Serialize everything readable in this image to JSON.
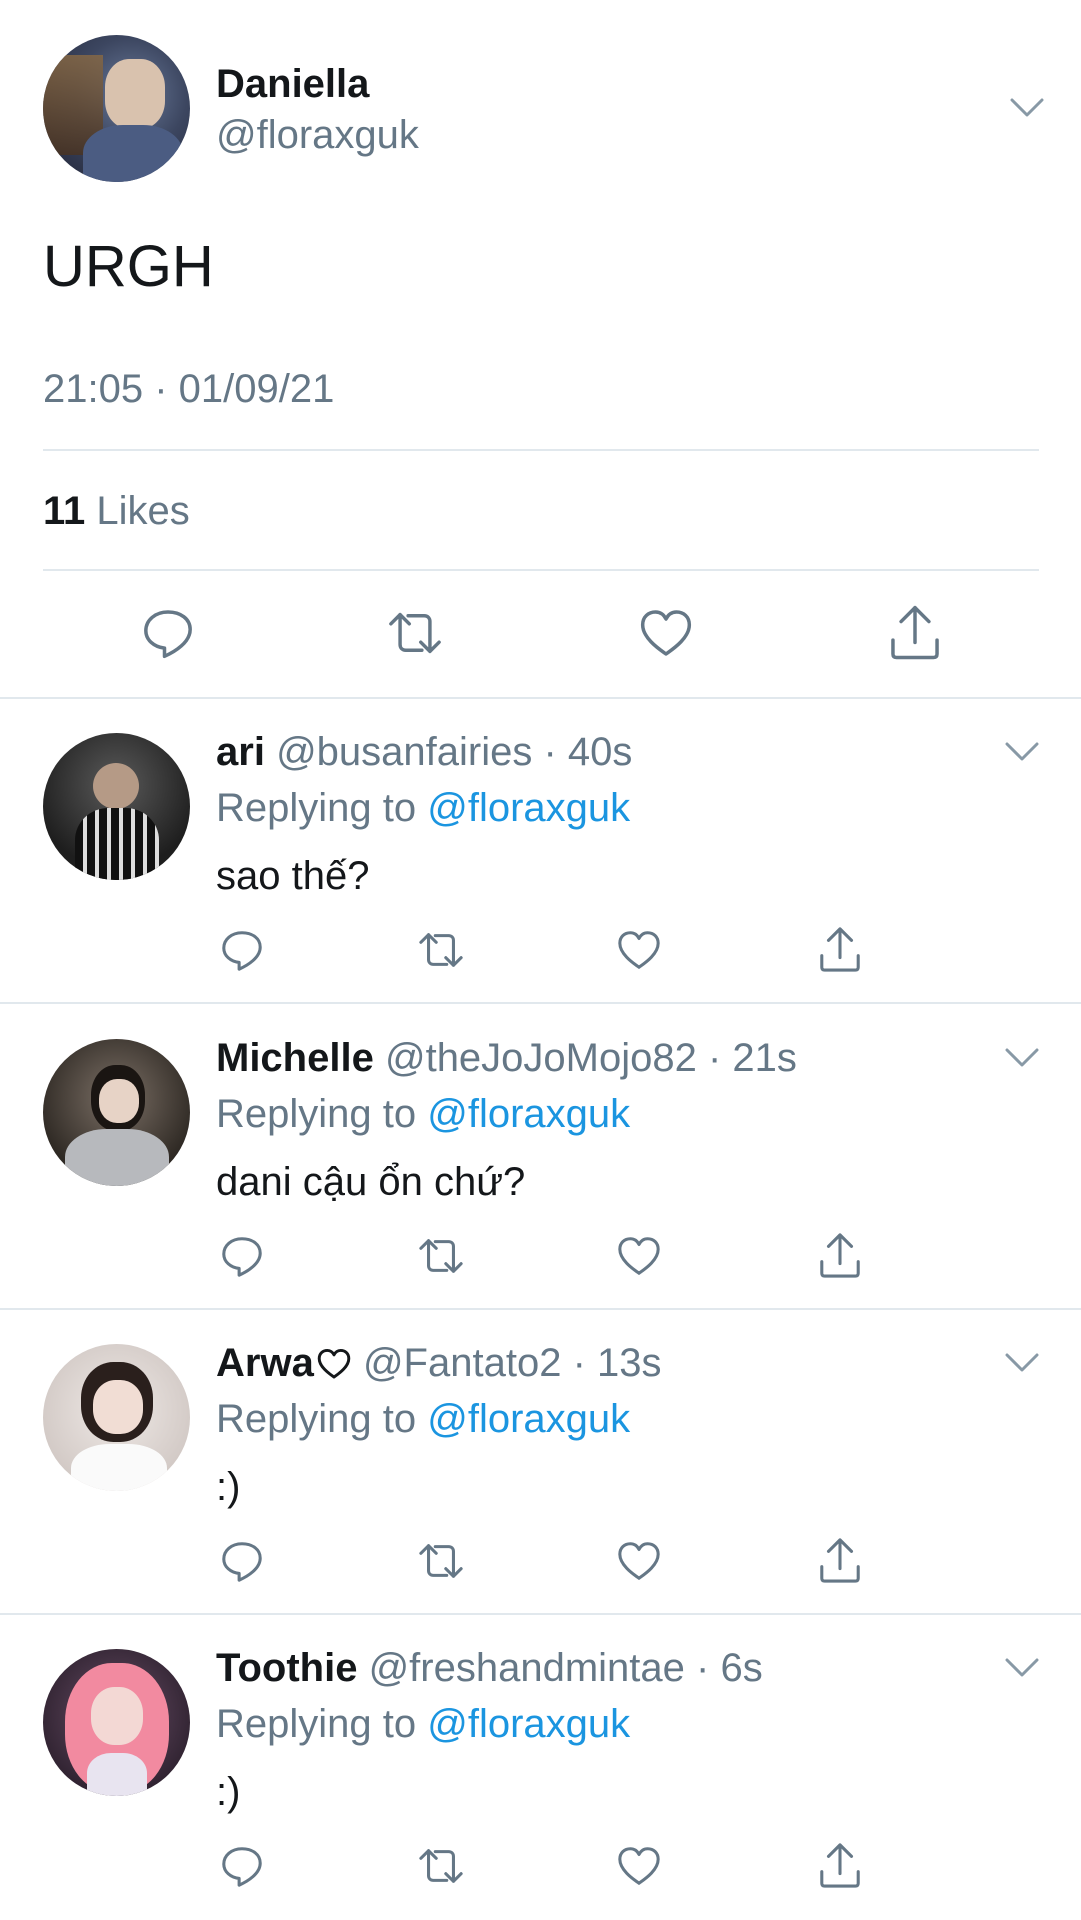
{
  "main_tweet": {
    "display_name": "Daniella",
    "handle": "@floraxguk",
    "text": "URGH",
    "timestamp": "21:05 · 01/09/21",
    "likes_count": "11",
    "likes_label": "Likes"
  },
  "replying_label": "Replying to",
  "replies": [
    {
      "name": "ari",
      "handle": "@busanfairies",
      "time": "· 40s",
      "reply_to": "@floraxguk",
      "text": "sao thế?"
    },
    {
      "name": "Michelle",
      "handle": "@theJoJoMojo82",
      "time": "· 21s",
      "reply_to": "@floraxguk",
      "text": "dani cậu ổn chứ?"
    },
    {
      "name": "Arwa",
      "handle": "@Fantato2",
      "time": "· 13s",
      "reply_to": "@floraxguk",
      "text": ":)"
    },
    {
      "name": "Toothie",
      "handle": "@freshandmintae",
      "time": "· 6s",
      "reply_to": "@floraxguk",
      "text": ":)"
    }
  ],
  "colors": {
    "accent": "#1b95e0",
    "muted": "#657786",
    "divider": "#e1e8ed",
    "text": "#14171a"
  },
  "icons": [
    "reply-icon",
    "retweet-icon",
    "like-icon",
    "share-icon",
    "chevron-down-icon"
  ]
}
